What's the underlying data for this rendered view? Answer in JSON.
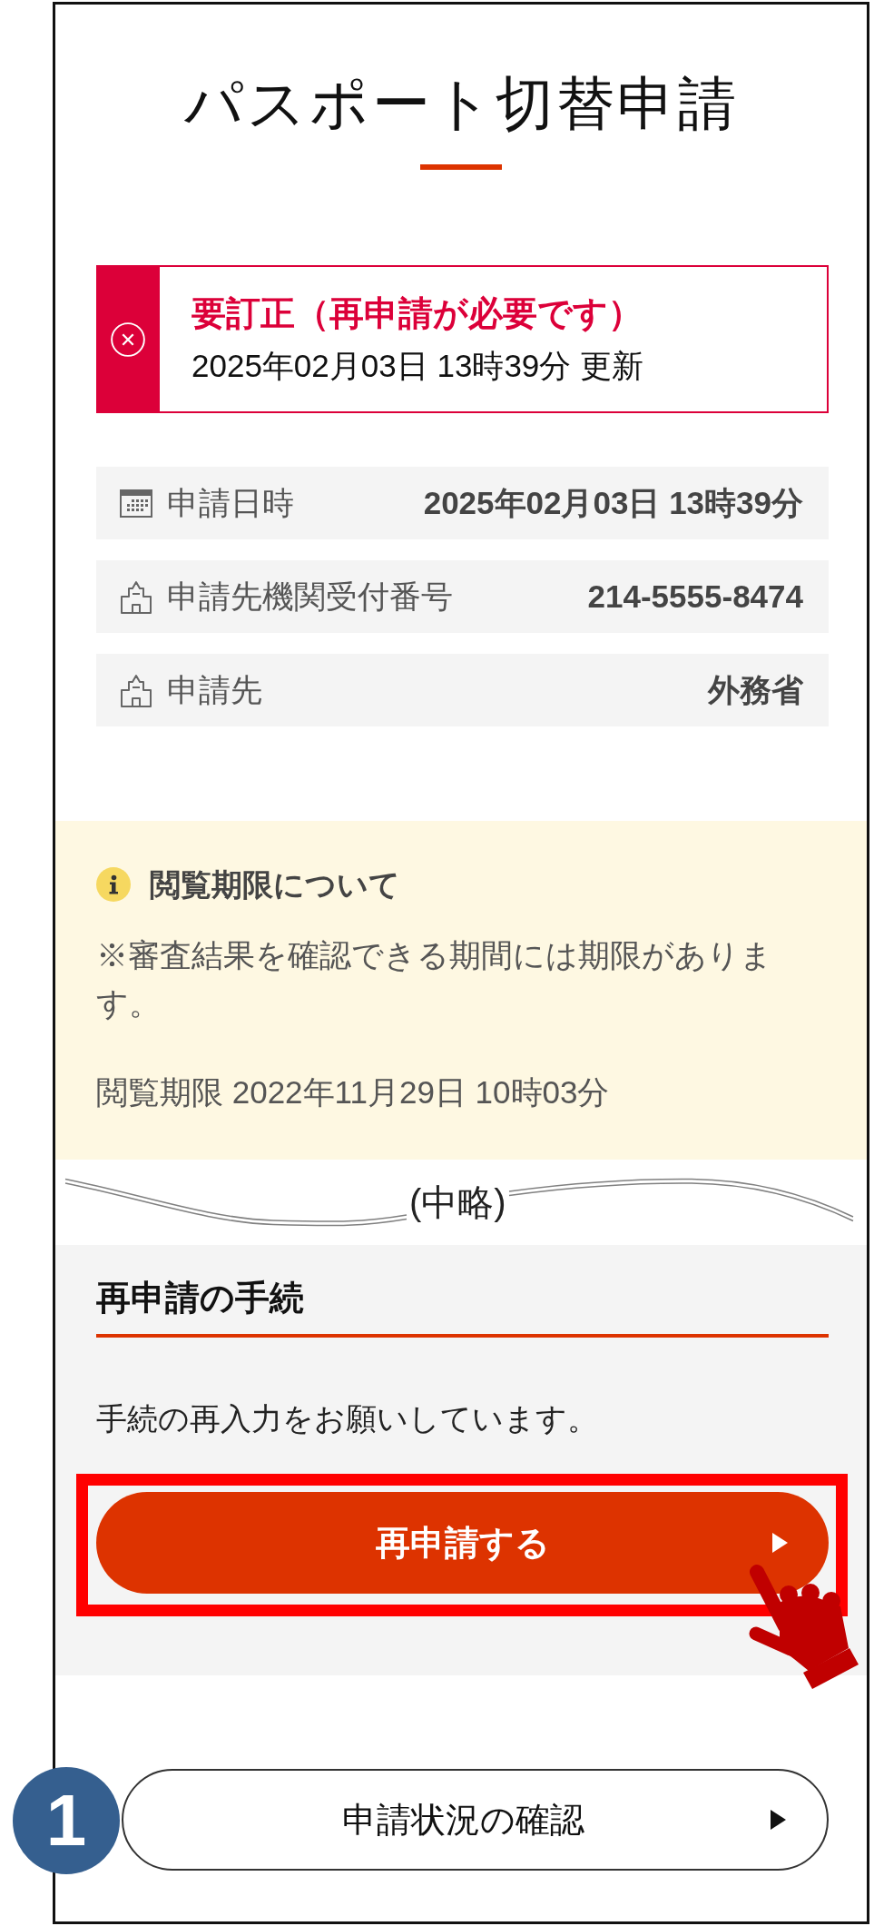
{
  "page": {
    "title": "パスポート切替申請"
  },
  "status": {
    "kind": "error",
    "title": "要訂正（再申請が必要です）",
    "updated": "2025年02月03日 13時39分 更新"
  },
  "details": [
    {
      "kind": "date",
      "label": "申請日時",
      "value": "2025年02月03日 13時39分"
    },
    {
      "kind": "office",
      "label": "申請先機関受付番号",
      "value": "214-5555-8474"
    },
    {
      "kind": "office",
      "label": "申請先",
      "value": "外務省"
    }
  ],
  "notice": {
    "title": "閲覧期限について",
    "body": "※審査結果を確認できる期間には期限があります。",
    "deadline": "閲覧期限 2022年11月29日 10時03分"
  },
  "omission": {
    "label": "(中略)"
  },
  "resubmit": {
    "heading": "再申請の手続",
    "message": "手続の再入力をお願いしています。",
    "button": {
      "label": "再申請する",
      "highlighted": true,
      "pointer": true
    }
  },
  "status_check": {
    "button": {
      "label": "申請状況の確認"
    },
    "step": "1"
  }
}
